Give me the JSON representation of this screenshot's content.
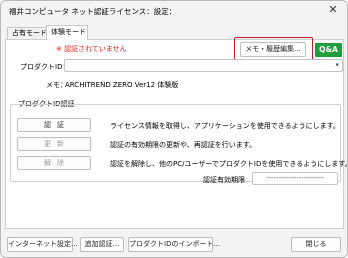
{
  "window": {
    "title": "福井コンピュータ ネット認証ライセンス：設定：",
    "close_glyph": "✕"
  },
  "tabs": [
    {
      "label": "占有モード",
      "active": false
    },
    {
      "label": "体験モード",
      "active": true
    }
  ],
  "status": {
    "error_text": "※ 認証されていません"
  },
  "toolbar": {
    "memo_history_label": "メモ・履歴編集...",
    "qa_label": "Q&A"
  },
  "product": {
    "label": "プロダクトID：",
    "value": "",
    "dropdown_icon": "chevron-down-icon"
  },
  "memo": {
    "label": "メモ：",
    "value": "ARCHITREND ZERO Ver12 体験版"
  },
  "auth_group": {
    "label": "プロダクトID認証",
    "actions": [
      {
        "label": "認証",
        "description": "ライセンス情報を取得し、アプリケーションを使用できるようにします。",
        "enabled": true
      },
      {
        "label": "更新",
        "description": "認証の有効期限の更新や、再認証を行います。",
        "enabled": false
      },
      {
        "label": "解除",
        "description": "認証を解除し、他のPC/ユーザーでプロダクトIDを使用できるようにします。",
        "enabled": false
      }
    ],
    "expiry_label": "認証有効期限",
    "expiry_value": "-----------------------"
  },
  "footer": {
    "internet_settings": "インターネット設定...",
    "add_auth": "追加認証...",
    "import_product_id": "プロダクトIDのインポート...",
    "close": "閉じる"
  },
  "colors": {
    "error": "#e02020",
    "highlight_box": "#c0202a",
    "qa_bg": "#1f9f3b"
  }
}
